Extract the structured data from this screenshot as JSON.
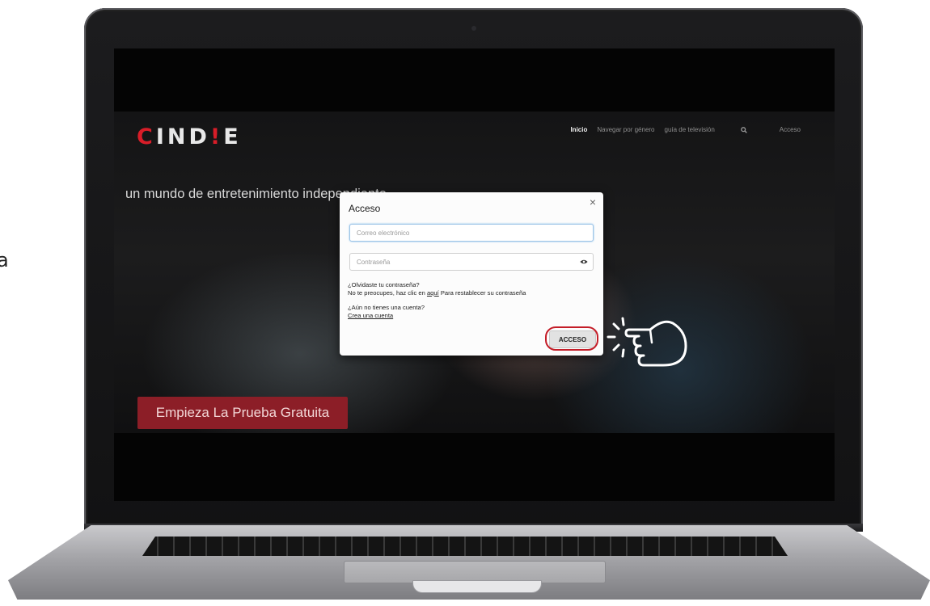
{
  "stray_letter": "a",
  "site": {
    "logo": {
      "c": "C",
      "ind": "IND",
      "bang": "!",
      "e": "E"
    },
    "nav": {
      "items": [
        "Inicio",
        "Navegar por género",
        "guía de televisión"
      ],
      "login": "Acceso"
    },
    "hero_text": "un mundo de entretenimiento independiente",
    "trial_button": "Empieza La Prueba Gratuita"
  },
  "login_modal": {
    "title": "Acceso",
    "close": "×",
    "email_placeholder": "Correo electrónico",
    "password_placeholder": "Contraseña",
    "forgot_question": "¿Olvidaste tu contraseña?",
    "forgot_text_before": "No te preocupes, haz clic en",
    "forgot_link": "aquí",
    "forgot_text_after": "Para restablecer su contraseña",
    "no_account": "¿Aún no tienes una cuenta?",
    "create_account": "Crea una cuenta",
    "submit": "ACCESO"
  },
  "colors": {
    "brand_red": "#d81d28",
    "highlight_ring": "#c41d28",
    "trial_button_bg": "#8c1e27"
  },
  "icons": [
    "search-icon",
    "eye-icon",
    "close-icon",
    "pointing-hand-icon"
  ]
}
